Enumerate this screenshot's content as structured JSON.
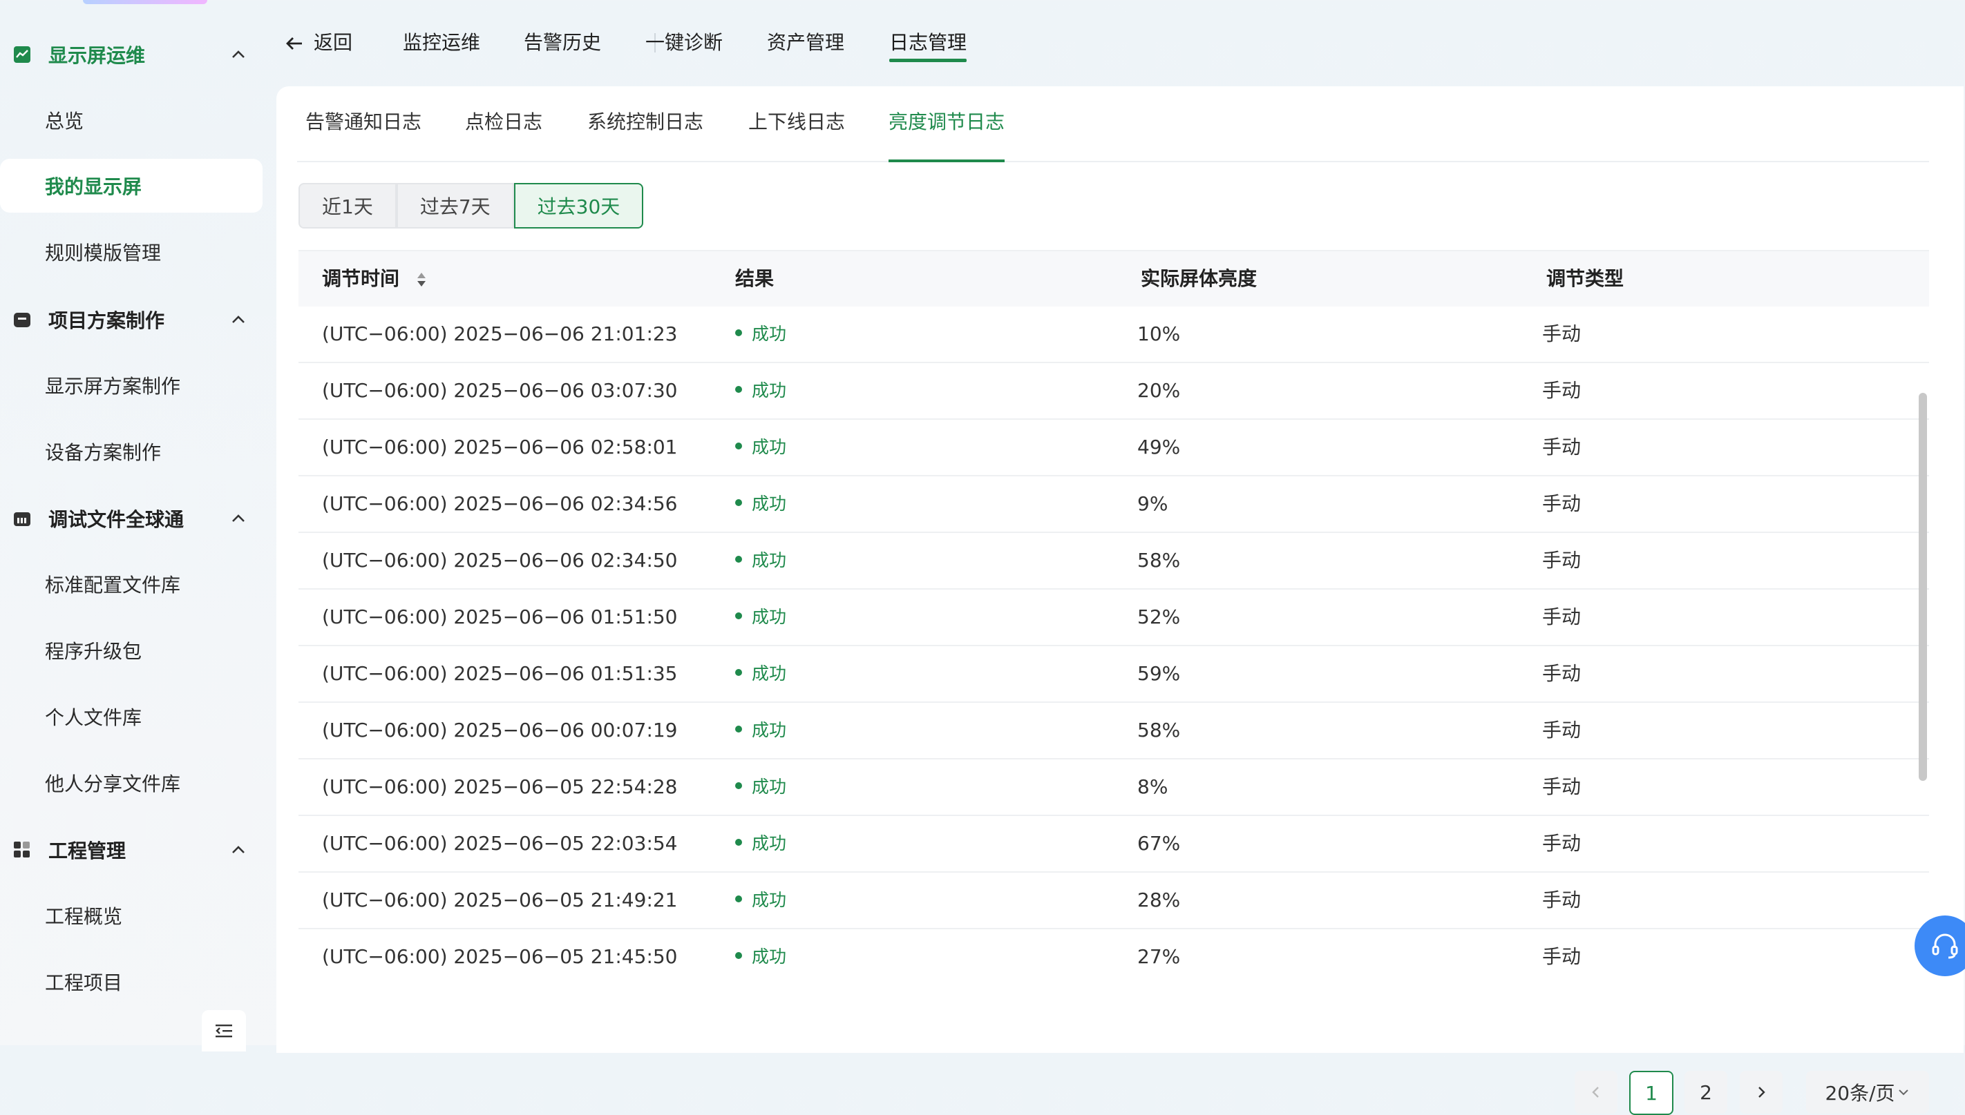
{
  "sidebar": {
    "groups": [
      {
        "label": "显示屏运维",
        "items": [
          "总览",
          "我的显示屏",
          "规则模版管理"
        ]
      },
      {
        "label": "项目方案制作",
        "items": [
          "显示屏方案制作",
          "设备方案制作"
        ]
      },
      {
        "label": "调试文件全球通",
        "items": [
          "标准配置文件库",
          "程序升级包",
          "个人文件库",
          "他人分享文件库"
        ]
      },
      {
        "label": "工程管理",
        "items": [
          "工程概览",
          "工程项目"
        ]
      }
    ],
    "active_item": "我的显示屏"
  },
  "topnav": {
    "back_label": "返回",
    "items": [
      "监控运维",
      "告警历史",
      "一键诊断",
      "资产管理",
      "日志管理"
    ],
    "active": "日志管理"
  },
  "subtabs": {
    "items": [
      "告警通知日志",
      "点检日志",
      "系统控制日志",
      "上下线日志",
      "亮度调节日志"
    ],
    "active": "亮度调节日志"
  },
  "range": {
    "options": [
      "近1天",
      "过去7天",
      "过去30天"
    ],
    "active": "过去30天"
  },
  "table": {
    "columns": [
      "调节时间",
      "结果",
      "实际屏体亮度",
      "调节类型"
    ],
    "rows": [
      {
        "time": "(UTC−06:00) 2025−06−06 21:01:23",
        "result": "成功",
        "brightness": "10%",
        "type": "手动"
      },
      {
        "time": "(UTC−06:00) 2025−06−06 03:07:30",
        "result": "成功",
        "brightness": "20%",
        "type": "手动"
      },
      {
        "time": "(UTC−06:00) 2025−06−06 02:58:01",
        "result": "成功",
        "brightness": "49%",
        "type": "手动"
      },
      {
        "time": "(UTC−06:00) 2025−06−06 02:34:56",
        "result": "成功",
        "brightness": "9%",
        "type": "手动"
      },
      {
        "time": "(UTC−06:00) 2025−06−06 02:34:50",
        "result": "成功",
        "brightness": "58%",
        "type": "手动"
      },
      {
        "time": "(UTC−06:00) 2025−06−06 01:51:50",
        "result": "成功",
        "brightness": "52%",
        "type": "手动"
      },
      {
        "time": "(UTC−06:00) 2025−06−06 01:51:35",
        "result": "成功",
        "brightness": "59%",
        "type": "手动"
      },
      {
        "time": "(UTC−06:00) 2025−06−06 00:07:19",
        "result": "成功",
        "brightness": "58%",
        "type": "手动"
      },
      {
        "time": "(UTC−06:00) 2025−06−05 22:54:28",
        "result": "成功",
        "brightness": "8%",
        "type": "手动"
      },
      {
        "time": "(UTC−06:00) 2025−06−05 22:03:54",
        "result": "成功",
        "brightness": "67%",
        "type": "手动"
      },
      {
        "time": "(UTC−06:00) 2025−06−05 21:49:21",
        "result": "成功",
        "brightness": "28%",
        "type": "手动"
      },
      {
        "time": "(UTC−06:00) 2025−06−05 21:45:50",
        "result": "成功",
        "brightness": "27%",
        "type": "手动"
      }
    ]
  },
  "pagination": {
    "prev_icon": "chevron-left-icon",
    "pages": [
      "1",
      "2"
    ],
    "current": "1",
    "next_icon": "chevron-right-icon",
    "page_size": "20条/页"
  },
  "colors": {
    "accent": "#1f8a4c",
    "support": "#3d8af7"
  }
}
